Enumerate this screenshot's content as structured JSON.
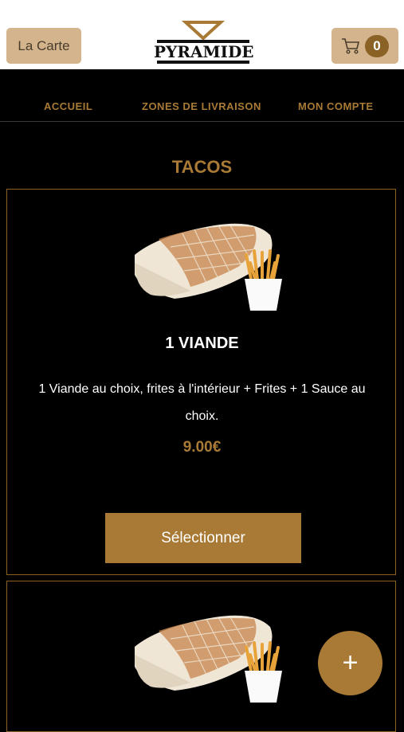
{
  "header": {
    "menu_button_label": "La Carte",
    "logo_text": "PYRAMIDE",
    "cart_count": "0",
    "cart_icon": "shopping-cart-icon"
  },
  "nav": {
    "items": [
      {
        "label": "ACCUEIL"
      },
      {
        "label": "ZONES DE LIVRAISON"
      },
      {
        "label": "MON COMPTE"
      }
    ]
  },
  "section": {
    "title": "TACOS"
  },
  "products": [
    {
      "name": "1 VIANDE",
      "description": "1 Viande au choix, frites à l'intérieur  + Frites  + 1 Sauce au choix.",
      "price": "9.00€",
      "button_label": "Sélectionner",
      "image_icon": "tacos-with-fries-image"
    },
    {
      "image_icon": "tacos-with-fries-image"
    }
  ],
  "fab": {
    "label": "+"
  },
  "colors": {
    "accent": "#a97a35",
    "button_light": "#d4b48c",
    "background": "#000000"
  }
}
